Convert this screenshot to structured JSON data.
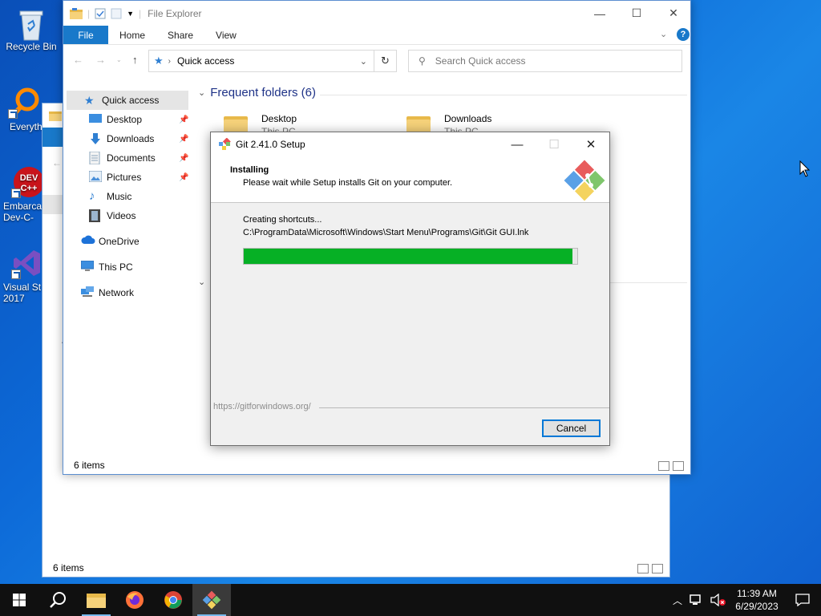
{
  "desktop": {
    "icons": [
      {
        "label": "Recycle Bin"
      },
      {
        "label": "Everyth"
      },
      {
        "label": "Embarca Dev-C-"
      },
      {
        "label": "Visual St 2017"
      }
    ]
  },
  "explorer": {
    "title": "File Explorer",
    "tabs": {
      "file": "File",
      "home": "Home",
      "share": "Share",
      "view": "View"
    },
    "address": "Quick access",
    "search_placeholder": "Search Quick access",
    "nav": {
      "quick_access": "Quick access",
      "desktop": "Desktop",
      "downloads": "Downloads",
      "documents": "Documents",
      "pictures": "Pictures",
      "music": "Music",
      "videos": "Videos",
      "onedrive": "OneDrive",
      "this_pc": "This PC",
      "network": "Network"
    },
    "section_title": "Frequent folders (6)",
    "folders": [
      {
        "name": "Desktop",
        "sub": "This PC"
      },
      {
        "name": "Downloads",
        "sub": "This PC"
      }
    ],
    "status": "6 items"
  },
  "background_explorer": {
    "status": "6 items"
  },
  "setup": {
    "title": "Git 2.41.0 Setup",
    "heading": "Installing",
    "subheading": "Please wait while Setup installs Git on your computer.",
    "status_line": "Creating shortcuts...",
    "path_line": "C:\\ProgramData\\Microsoft\\Windows\\Start Menu\\Programs\\Git\\Git GUI.lnk",
    "progress": 0.985,
    "url": "https://gitforwindows.org/",
    "cancel_label": "Cancel"
  },
  "taskbar": {
    "time": "11:39 AM",
    "date": "6/29/2023"
  },
  "colors": {
    "accent": "#1979ca",
    "progress": "#06b025",
    "taskbar": "#101010"
  }
}
